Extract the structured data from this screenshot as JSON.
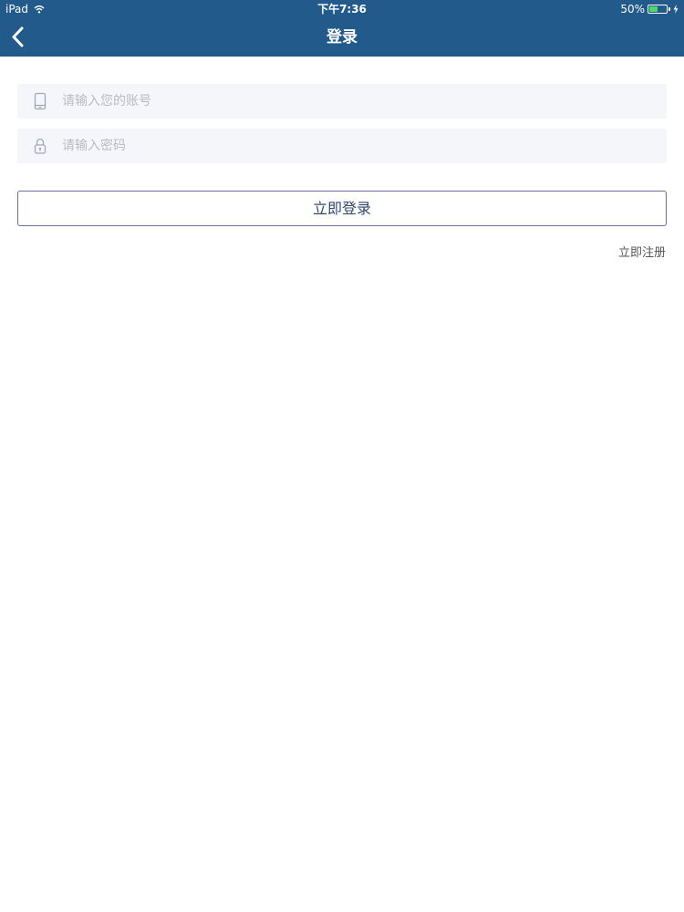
{
  "status_bar": {
    "device": "iPad",
    "time": "下午7:36",
    "battery_percent": "50%",
    "battery_level": 0.5,
    "battery_color": "#4cd964"
  },
  "nav": {
    "title": "登录",
    "back_icon": "chevron-left-icon",
    "background": "#225a8c"
  },
  "form": {
    "account": {
      "icon": "phone-icon",
      "placeholder": "请输入您的账号",
      "value": ""
    },
    "password": {
      "icon": "lock-icon",
      "placeholder": "请输入密码",
      "value": ""
    },
    "login_button": "立即登录",
    "register_link": "立即注册"
  }
}
